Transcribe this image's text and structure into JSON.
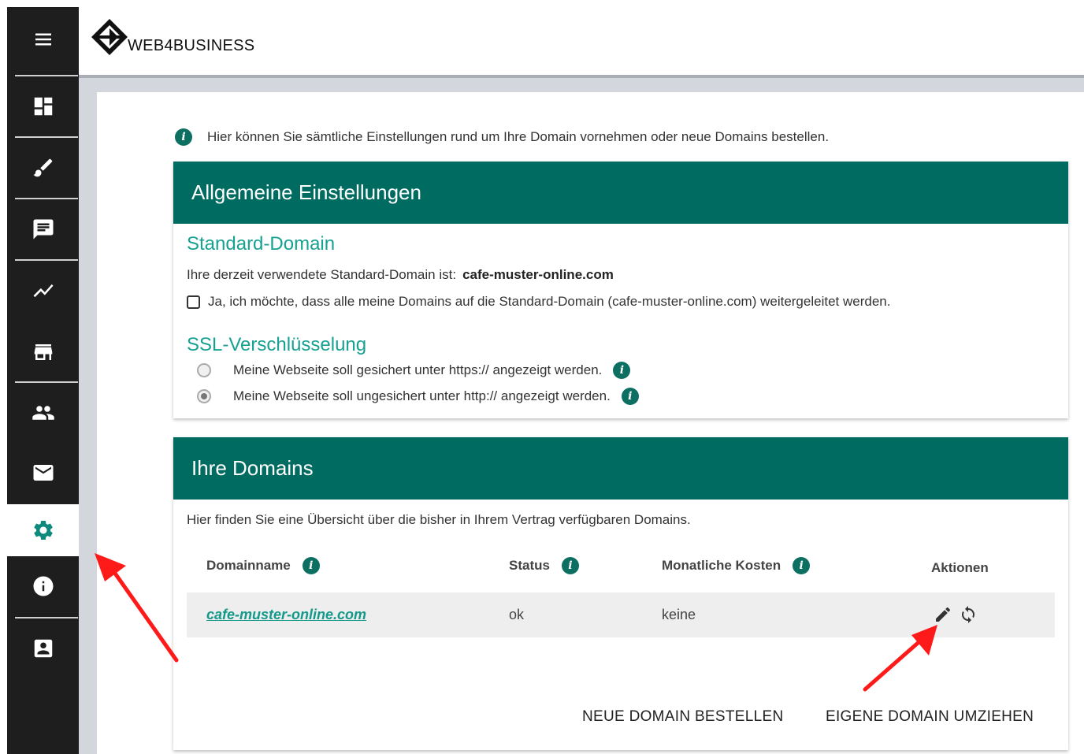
{
  "brand": {
    "name": "WEB4BUSINESS"
  },
  "sidebar": {
    "items": [
      {
        "icon": "menu-icon"
      },
      {
        "icon": "dashboard-icon"
      },
      {
        "icon": "brush-icon"
      },
      {
        "icon": "message-icon"
      },
      {
        "icon": "statistics-icon"
      },
      {
        "icon": "store-icon"
      },
      {
        "icon": "people-icon"
      },
      {
        "icon": "mail-icon"
      },
      {
        "icon": "settings-icon",
        "active": true
      },
      {
        "icon": "info-icon"
      },
      {
        "icon": "contact-icon"
      }
    ]
  },
  "intro": "Hier können Sie sämtliche Einstellungen rund um Ihre Domain vornehmen oder neue Domains bestellen.",
  "general": {
    "title": "Allgemeine Einstellungen",
    "standard_domain": {
      "title": "Standard-Domain",
      "current_label": "Ihre derzeit verwendete Standard-Domain ist:",
      "current_value": "cafe-muster-online.com",
      "redirect_label": "Ja, ich möchte, dass alle meine Domains auf die Standard-Domain (cafe-muster-online.com) weitergeleitet werden.",
      "redirect_checked": false
    },
    "ssl": {
      "title": "SSL-Verschlüsselung",
      "options": [
        {
          "label": "Meine Webseite soll gesichert unter https:// angezeigt werden.",
          "selected": false
        },
        {
          "label": "Meine Webseite soll ungesichert unter http:// angezeigt werden.",
          "selected": true
        }
      ]
    }
  },
  "domains": {
    "title": "Ihre Domains",
    "description": "Hier finden Sie eine Übersicht über die bisher in Ihrem Vertrag verfügbaren Domains.",
    "columns": [
      "Domainname",
      "Status",
      "Monatliche Kosten",
      "Aktionen"
    ],
    "rows": [
      {
        "domain": "cafe-muster-online.com",
        "status": "ok",
        "cost": "keine",
        "actions": [
          "edit-icon",
          "transfer-icon"
        ]
      }
    ],
    "buttons": {
      "order": "NEUE DOMAIN BESTELLEN",
      "transfer": "EIGENE DOMAIN UMZIEHEN"
    }
  },
  "colors": {
    "primary": "#006b60",
    "accent": "#17a192",
    "sidebar": "#1e1e1e",
    "arrow": "#ff1a1a"
  }
}
